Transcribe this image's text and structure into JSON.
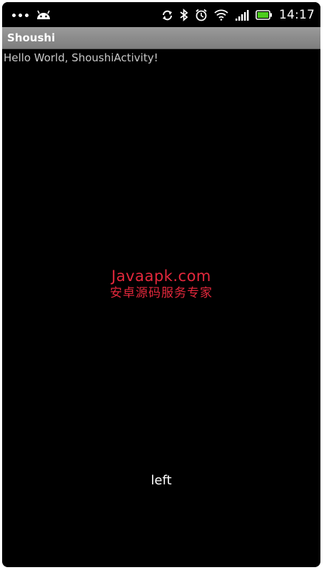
{
  "status_bar": {
    "time": "14:17",
    "icons": [
      "overflow-dots-icon",
      "android-icon",
      "sync-icon",
      "bluetooth-icon",
      "alarm-icon",
      "wifi-icon",
      "signal-icon",
      "battery-icon"
    ],
    "battery_color": "#4ccc1c"
  },
  "app": {
    "title": "Shoushi",
    "hello_text": "Hello World, ShoushiActivity!",
    "gesture_text": "left"
  },
  "watermark": {
    "line1": "Javaapk.com",
    "line2": "安卓源码服务专家",
    "color": "#e4283c"
  }
}
